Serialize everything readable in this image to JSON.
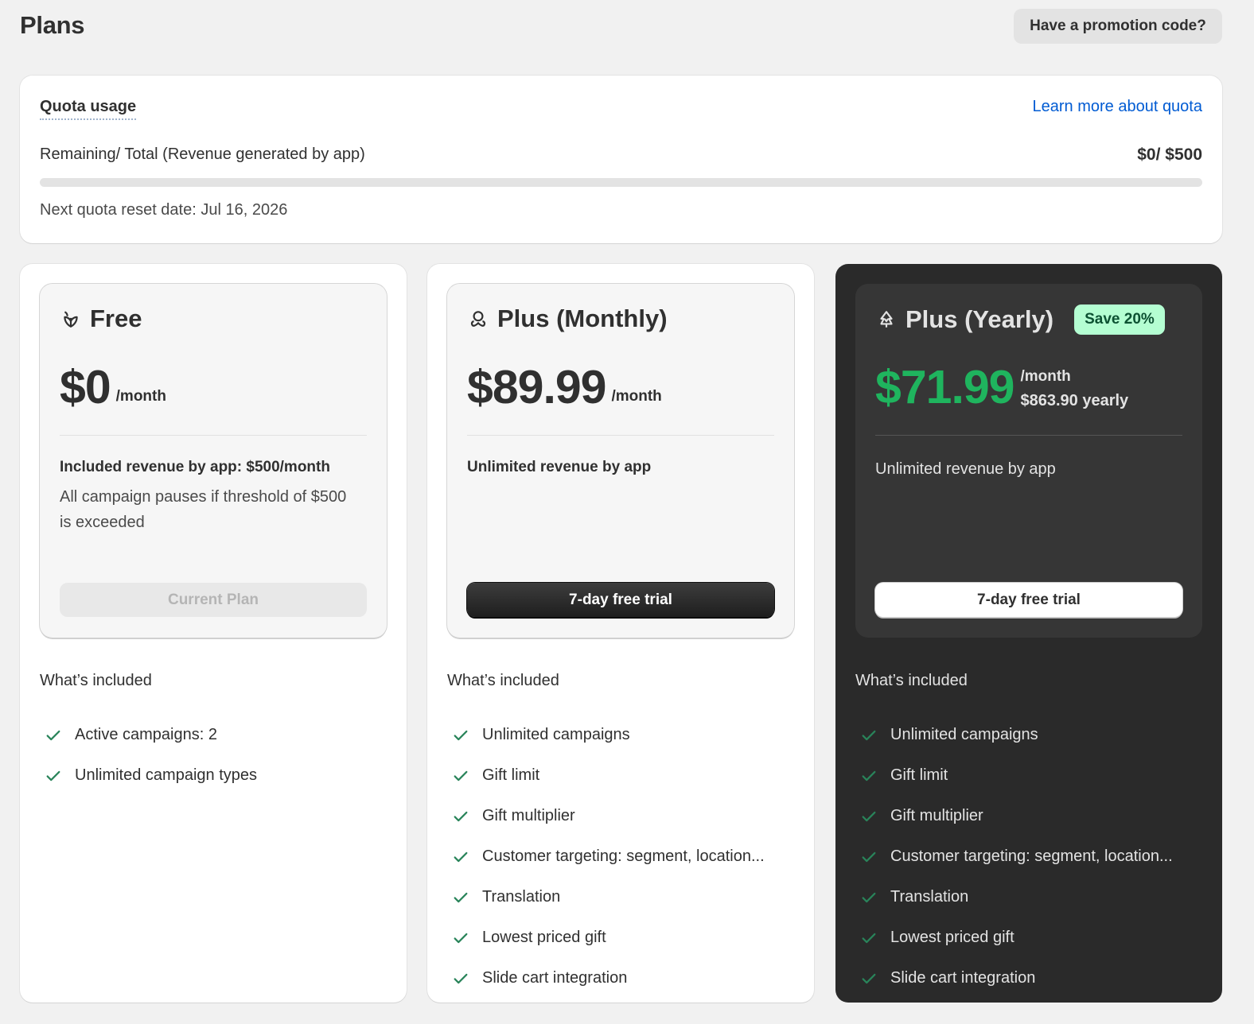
{
  "header": {
    "title": "Plans",
    "promo_label": "Have a promotion code?"
  },
  "quota": {
    "title": "Quota usage",
    "learn_more": "Learn more about quota",
    "label": "Remaining/ Total (Revenue generated by app)",
    "value": "$0/ $500",
    "progress_fraction": 0,
    "reset": "Next quota reset date: Jul 16, 2026"
  },
  "colors": {
    "accent_green": "#1fb45e",
    "check_green": "#29845a",
    "link_blue": "#005bd3",
    "badge_bg": "#b4fed2"
  },
  "plans": [
    {
      "name": "Free",
      "icon": "leaf-icon",
      "price": "$0",
      "per": "/month",
      "desc_strong": "Included revenue by app: $500/month",
      "desc_sub": "All campaign pauses if threshold of $500 is exceeded",
      "button": "Current Plan",
      "included_title": "What’s included",
      "features": [
        "Active campaigns: 2",
        "Unlimited campaign types"
      ]
    },
    {
      "name": "Plus (Monthly)",
      "icon": "flower-icon",
      "price": "$89.99",
      "per": "/month",
      "desc_strong": "Unlimited revenue by app",
      "button": "7-day free trial",
      "included_title": "What’s included",
      "features": [
        "Unlimited campaigns",
        "Gift limit",
        "Gift multiplier",
        "Customer targeting: segment, location...",
        "Translation",
        "Lowest priced gift",
        "Slide cart integration"
      ]
    },
    {
      "name": "Plus (Yearly)",
      "icon": "tree-icon",
      "badge": "Save 20%",
      "price": "$71.99",
      "per": "/month",
      "yearly": "$863.90 yearly",
      "desc_strong": "Unlimited revenue by app",
      "button": "7-day free trial",
      "included_title": "What’s included",
      "features": [
        "Unlimited campaigns",
        "Gift limit",
        "Gift multiplier",
        "Customer targeting: segment, location...",
        "Translation",
        "Lowest priced gift",
        "Slide cart integration"
      ]
    }
  ]
}
